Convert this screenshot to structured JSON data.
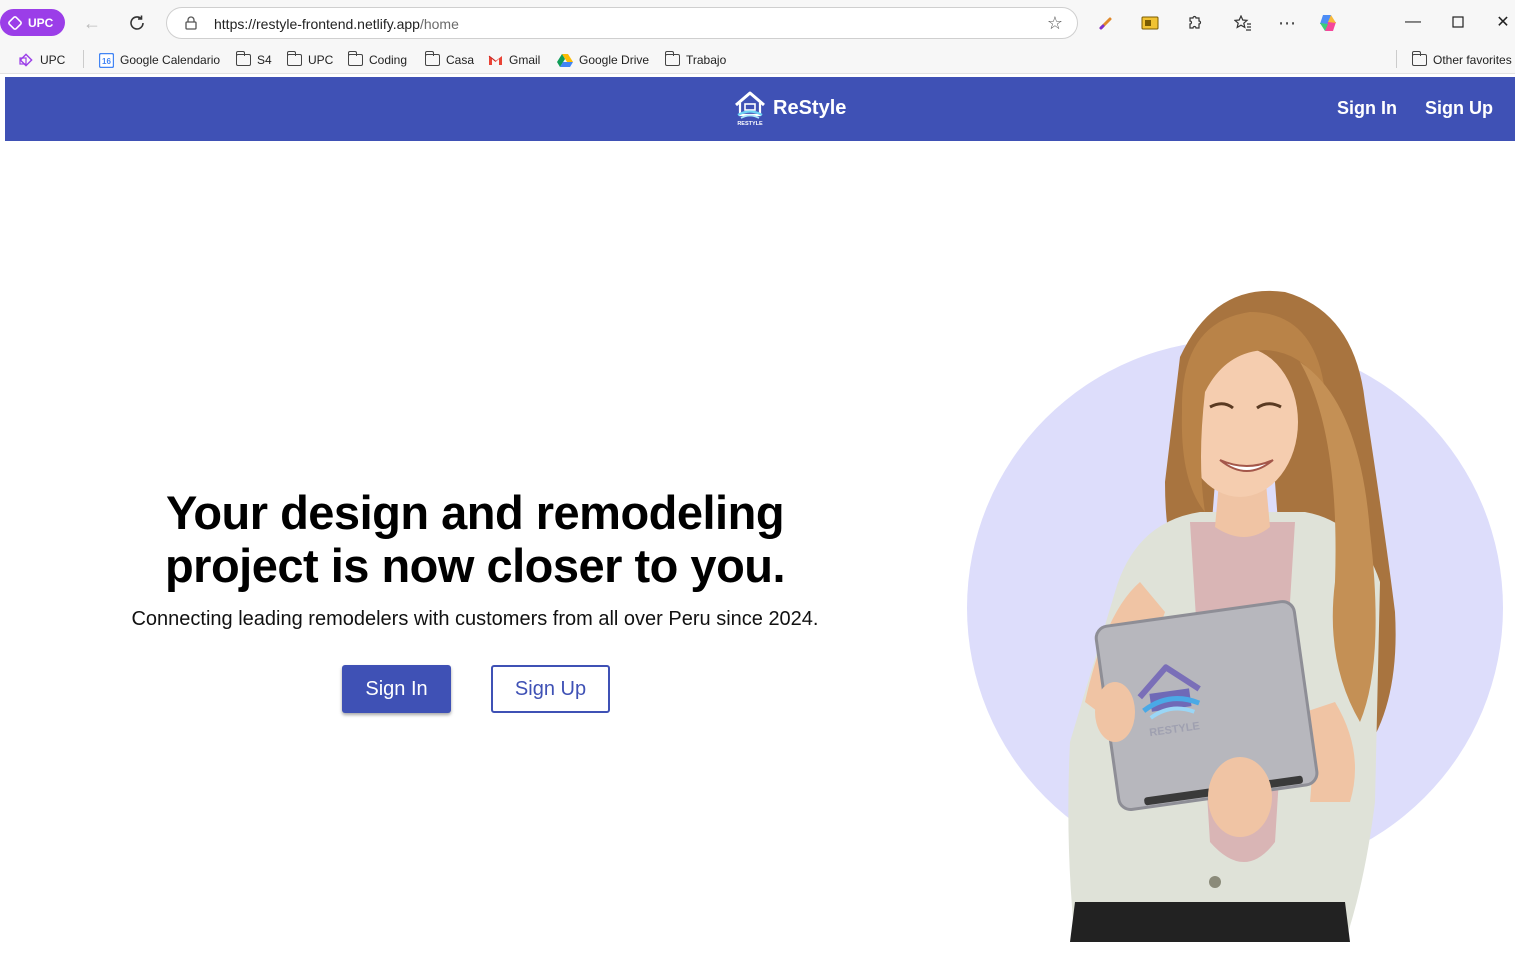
{
  "browser": {
    "profile_label": "UPC",
    "url_host": "https://restyle-frontend.netlify.app",
    "url_path": "/home"
  },
  "bookmarks": [
    {
      "label": "UPC",
      "icon": "upc-icon"
    },
    {
      "label": "Google Calendario",
      "icon": "calendar-icon"
    },
    {
      "label": "S4",
      "icon": "folder-icon"
    },
    {
      "label": "UPC",
      "icon": "folder-icon"
    },
    {
      "label": "Coding",
      "icon": "folder-icon"
    },
    {
      "label": "Casa",
      "icon": "folder-icon"
    },
    {
      "label": "Gmail",
      "icon": "gmail-icon"
    },
    {
      "label": "Google Drive",
      "icon": "drive-icon"
    },
    {
      "label": "Trabajo",
      "icon": "folder-icon"
    }
  ],
  "other_favorites": "Other favorites",
  "nav": {
    "brand": "ReStyle",
    "sign_in": "Sign In",
    "sign_up": "Sign Up"
  },
  "hero": {
    "title": "Your design and remodeling project is now closer to you.",
    "subtitle": "Connecting leading remodelers with customers from all over Peru since 2024.",
    "sign_in": "Sign In",
    "sign_up": "Sign Up",
    "image_logo_text": "RESTYLE"
  },
  "colors": {
    "primary": "#3f51b5",
    "circle": "#ddddfb",
    "profile": "#9b3ee8"
  }
}
